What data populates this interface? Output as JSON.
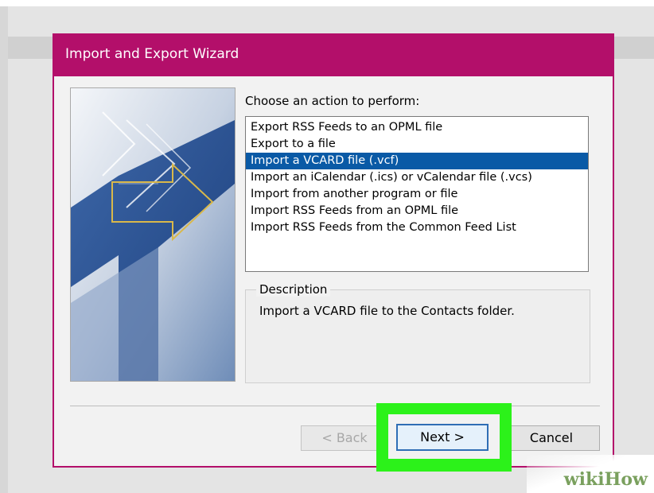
{
  "dialog": {
    "title": "Import and Export Wizard",
    "choose_label": "Choose an action to perform:",
    "actions": [
      "Export RSS Feeds to an OPML file",
      "Export to a file",
      "Import a VCARD file (.vcf)",
      "Import an iCalendar (.ics) or vCalendar file (.vcs)",
      "Import from another program or file",
      "Import RSS Feeds from an OPML file",
      "Import RSS Feeds from the Common Feed List"
    ],
    "selected_index": 2,
    "description_label": "Description",
    "description_text": "Import a VCARD file to the Contacts folder.",
    "buttons": {
      "back": "< Back",
      "next": "Next >",
      "cancel": "Cancel"
    }
  },
  "watermark": "wikiHow",
  "colors": {
    "title_bar": "#b30f6a",
    "selection": "#0a5aa6",
    "highlight_box": "#2cf21a"
  }
}
